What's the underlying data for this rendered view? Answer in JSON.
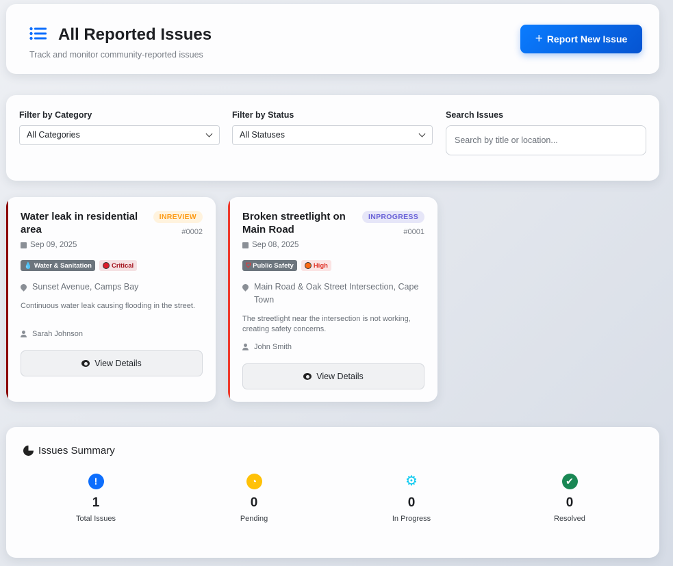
{
  "header": {
    "title": "All Reported Issues",
    "subtitle": "Track and monitor community-reported issues",
    "icon": "list-icon",
    "report_button": "Report New Issue"
  },
  "filters": {
    "category_label": "Filter by Category",
    "category_value": "All Categories",
    "status_label": "Filter by Status",
    "status_value": "All Statuses",
    "search_label": "Search Issues",
    "search_placeholder": "Search by title or location..."
  },
  "issues": [
    {
      "title": "Water leak in residential area",
      "status": "INREVIEW",
      "status_color": "#fd9a14",
      "status_bg": "#fff3de",
      "id": "#0002",
      "date": "Sep 09, 2025",
      "category": "Water & Sanitation",
      "priority": "Critical",
      "priority_color": "#dc1d2b",
      "priority_text": "#a3131e",
      "priority_bg": "#f5e1e3",
      "border_color": "#8b0000",
      "location": "Sunset Avenue, Camps Bay",
      "description": "Continuous water leak causing flooding in the street.",
      "reporter": "Sarah Johnson",
      "button": "View Details"
    },
    {
      "title": "Broken streetlight on Main Road",
      "status": "INPROGRESS",
      "status_color": "#6a63d8",
      "status_bg": "#e6e6f8",
      "id": "#0001",
      "date": "Sep 08, 2025",
      "category": "Public Safety",
      "priority": "High",
      "priority_color": "#fd6a14",
      "priority_text": "#e0352b",
      "priority_bg": "#fbe4e4",
      "border_color": "#ef3b2d",
      "location": "Main Road & Oak Street Intersection, Cape Town",
      "description": "The streetlight near the intersection is not working, creating safety concerns.",
      "reporter": "John Smith",
      "button": "View Details"
    }
  ],
  "summary": {
    "title": "Issues Summary",
    "stats": [
      {
        "label": "Total Issues",
        "value": "1",
        "icon": "exclamation-circle-icon",
        "color": "#0d6efd"
      },
      {
        "label": "Pending",
        "value": "0",
        "icon": "clock-icon",
        "color": "#ffc107"
      },
      {
        "label": "In Progress",
        "value": "0",
        "icon": "cogs-icon",
        "color": "#0dcaf0"
      },
      {
        "label": "Resolved",
        "value": "0",
        "icon": "check-circle-icon",
        "color": "#198754"
      }
    ]
  }
}
